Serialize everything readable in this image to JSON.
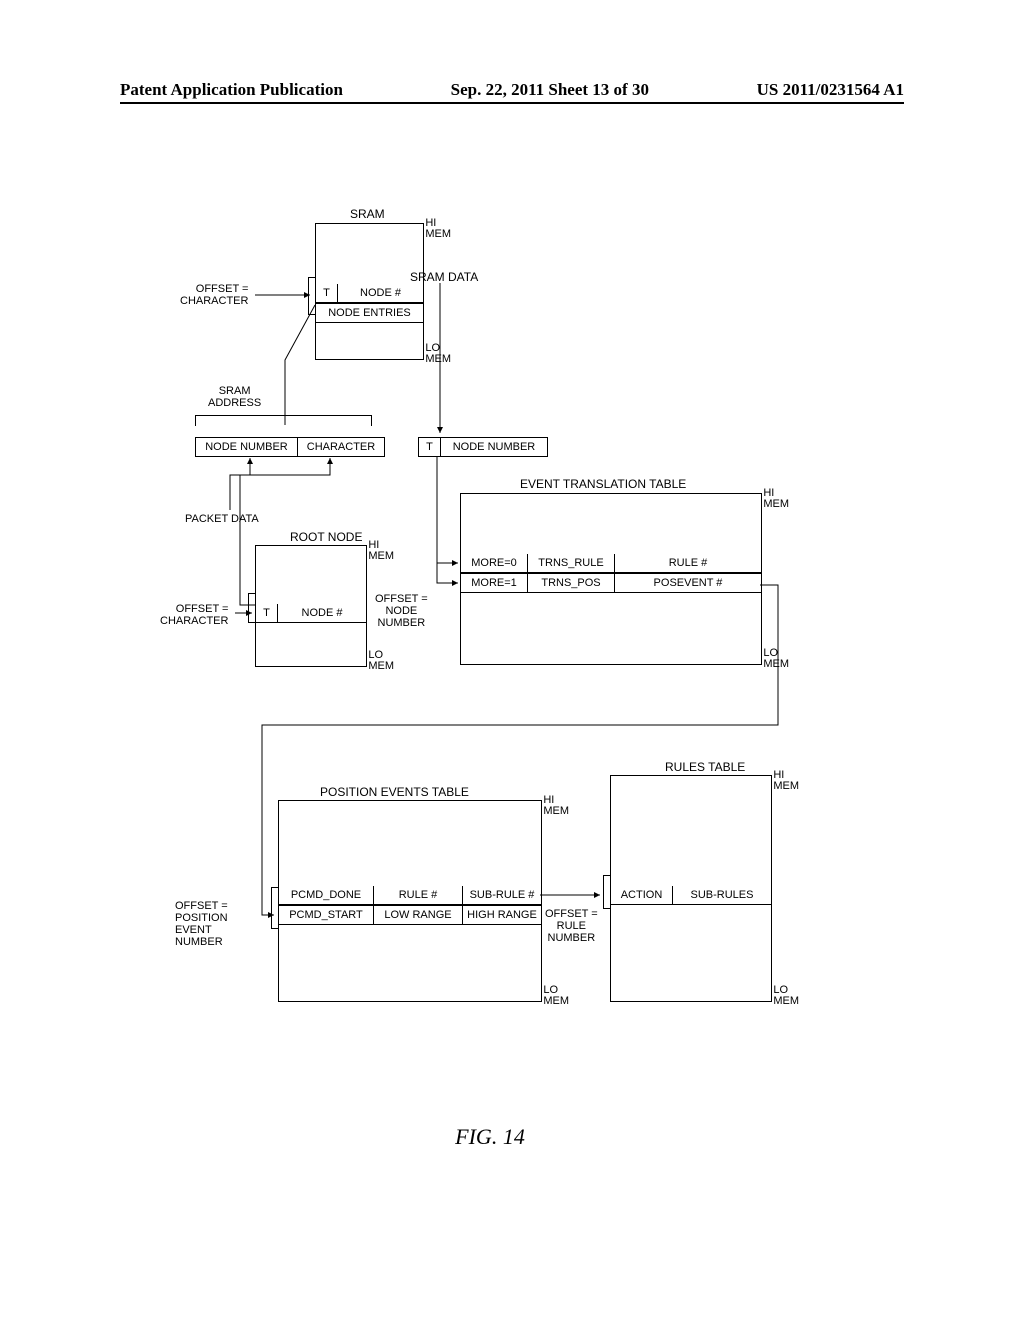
{
  "header": {
    "left": "Patent Application Publication",
    "center": "Sep. 22, 2011  Sheet 13 of 30",
    "right": "US 2011/0231564 A1"
  },
  "figure_label": "FIG. 14",
  "labels": {
    "sram_title": "SRAM",
    "sram_data": "SRAM DATA",
    "sram_address": "SRAM\nADDRESS",
    "offset_char": "OFFSET =\nCHARACTER",
    "offset_char2": "OFFSET =\nCHARACTER",
    "node_entries": "NODE ENTRIES",
    "node_number": "NODE NUMBER",
    "character": "CHARACTER",
    "packet_data": "PACKET DATA",
    "root_node": "ROOT NODE",
    "offset_node_num": "OFFSET =\nNODE\nNUMBER",
    "event_trans": "EVENT TRANSLATION TABLE",
    "more0": "MORE=0",
    "more1": "MORE=1",
    "trns_rule": "TRNS_RULE",
    "trns_pos": "TRNS_POS",
    "rule_num": "RULE #",
    "posevent_num": "POSEVENT #",
    "pos_events": "POSITION EVENTS TABLE",
    "pcmd_done": "PCMD_DONE",
    "pcmd_start": "PCMD_START",
    "low_range": "LOW RANGE",
    "high_range": "HIGH RANGE",
    "subrule_num": "SUB-RULE #",
    "offset_pos_event": "OFFSET =\nPOSITION\nEVENT\nNUMBER",
    "offset_rule_num": "OFFSET =\nRULE\nNUMBER",
    "rules_table": "RULES TABLE",
    "action": "ACTION",
    "sub_rules": "SUB-RULES",
    "hi_mem": "HI\nMEM",
    "lo_mem": "LO\nMEM",
    "t_col": "T",
    "node_col": "NODE #",
    "node_num_col": "NODE NUMBER"
  }
}
